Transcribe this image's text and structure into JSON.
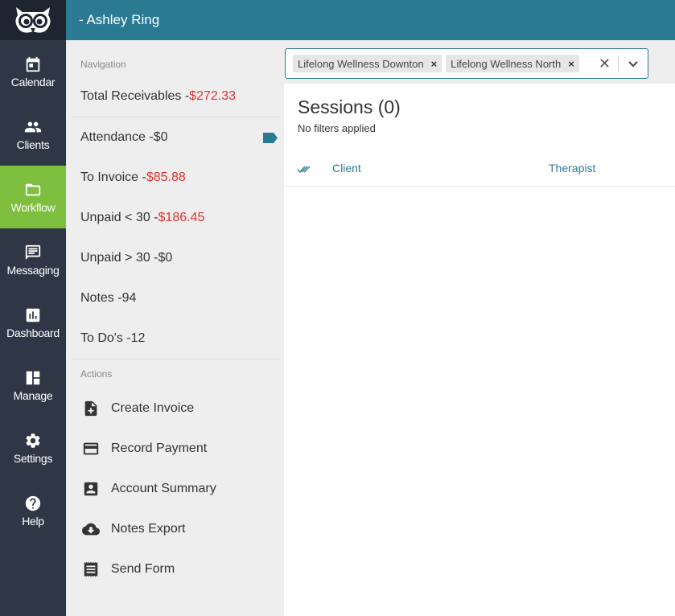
{
  "header": {
    "title": "- Ashley Ring"
  },
  "rail": {
    "items": [
      {
        "label": "Calendar"
      },
      {
        "label": "Clients"
      },
      {
        "label": "Workflow"
      },
      {
        "label": "Messaging"
      },
      {
        "label": "Dashboard"
      },
      {
        "label": "Manage"
      },
      {
        "label": "Settings"
      },
      {
        "label": "Help"
      }
    ],
    "active": "Workflow",
    "active_color": "#7fbf3f"
  },
  "navigation": {
    "label": "Navigation",
    "items": [
      {
        "label": "Total Receivables - ",
        "amount": "$272.33",
        "red": true
      },
      {
        "label": "Attendance - ",
        "amount": "$0",
        "red": false
      },
      {
        "label": "To Invoice - ",
        "amount": "$85.88",
        "red": true
      },
      {
        "label": "Unpaid < 30 - ",
        "amount": "$186.45",
        "red": true
      },
      {
        "label": "Unpaid > 30 - ",
        "amount": "$0",
        "red": false
      },
      {
        "label": "Notes - ",
        "amount": "94",
        "red": false
      },
      {
        "label": "To Do's - ",
        "amount": "12",
        "red": false
      }
    ]
  },
  "actions": {
    "label": "Actions",
    "items": [
      {
        "label": "Create Invoice",
        "icon": "add-file-icon"
      },
      {
        "label": "Record Payment",
        "icon": "credit-card-icon"
      },
      {
        "label": "Account Summary",
        "icon": "account-box-icon"
      },
      {
        "label": "Notes Export",
        "icon": "cloud-download-icon"
      },
      {
        "label": "Send Form",
        "icon": "receipt-icon"
      }
    ]
  },
  "filter": {
    "chips": [
      "Lifelong Wellness Downton",
      "Lifelong Wellness North"
    ]
  },
  "sessions": {
    "title": "Sessions (0)",
    "subtitle": "No filters applied",
    "columns": {
      "client": "Client",
      "therapist": "Therapist"
    }
  },
  "colors": {
    "header": "#2b7a94",
    "rail": "#2f3746",
    "red_amount": "#e0342f"
  }
}
